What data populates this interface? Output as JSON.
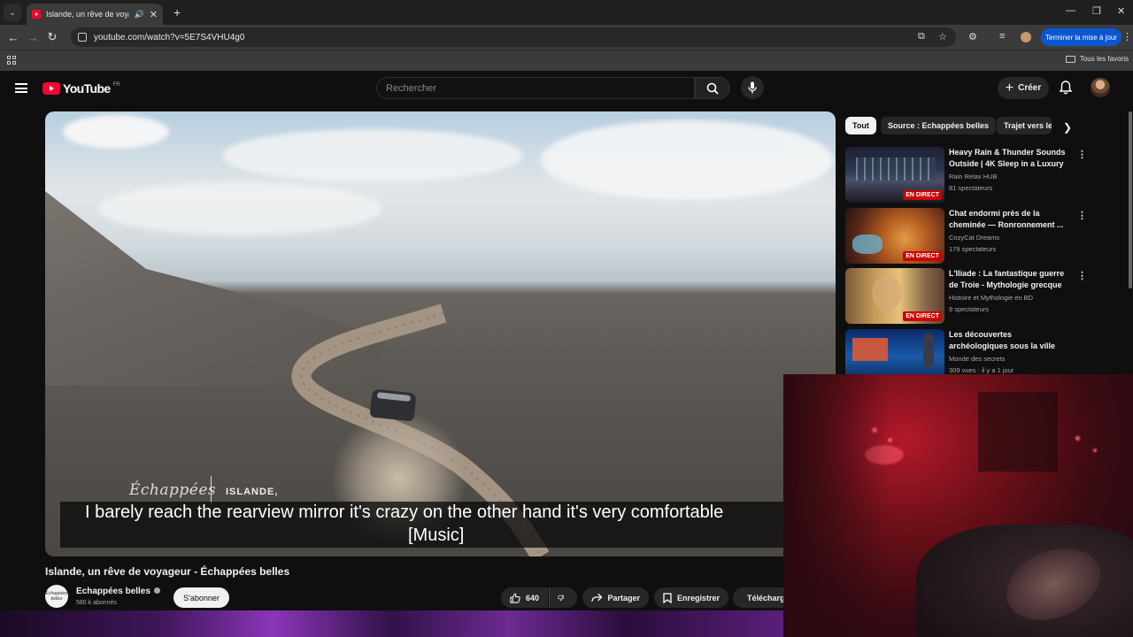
{
  "browser": {
    "tab_title": "Islande, un rêve de voyageur",
    "url": "youtube.com/watch?v=5E7S4VHU4g0",
    "update_label": "Terminer la mise à jour",
    "all_favorites": "Tous les favoris"
  },
  "header": {
    "logo_text": "YouTube",
    "logo_country": "FR",
    "search_placeholder": "Rechercher",
    "create_label": "Créer"
  },
  "video": {
    "brand": "Échappées",
    "location": "ISLANDE,",
    "caption_line1": "I barely reach the rearview mirror it's crazy on the other hand it's very comfortable",
    "caption_line2": "[Music]",
    "title": "Islande, un rêve de voyageur - Échappées belles",
    "channel_name": "Echappées belles",
    "channel_avatar_text": "Échappées belles",
    "subscribers": "580 k abonnés",
    "subscribe_label": "S'abonner",
    "likes": "640",
    "share_label": "Partager",
    "save_label": "Enregistrer",
    "download_label": "Télécharger"
  },
  "chips": [
    "Tout",
    "Source : Echappées belles",
    "Trajet vers le"
  ],
  "recommendations": [
    {
      "title": "Heavy Rain & Thunder Sounds Outside | 4K Sleep in a Luxury ...",
      "channel": "Rain Relax HUB",
      "meta": "81 spectateurs",
      "badge": "EN DIRECT"
    },
    {
      "title": "Chat endormi près de la cheminée — Ronronnement ...",
      "channel": "CozyCat Dreams",
      "meta": "179 spectateurs",
      "badge": "EN DIRECT"
    },
    {
      "title": "L'Iliade : La fantastique guerre de Troie - Mythologie grecque",
      "channel": "Histoire et Mythologie en BD",
      "meta": "9 spectateurs",
      "badge": "EN DIRECT"
    },
    {
      "title": "Les découvertes archéologiques sous la ville de...",
      "channel": "Monde des secrets",
      "meta": "309 vues · il y a 1 jour",
      "badge": ""
    }
  ],
  "colors": {
    "brand_red": "#ff0033",
    "live_red": "#cc0000",
    "update_blue": "#0b57d0"
  }
}
